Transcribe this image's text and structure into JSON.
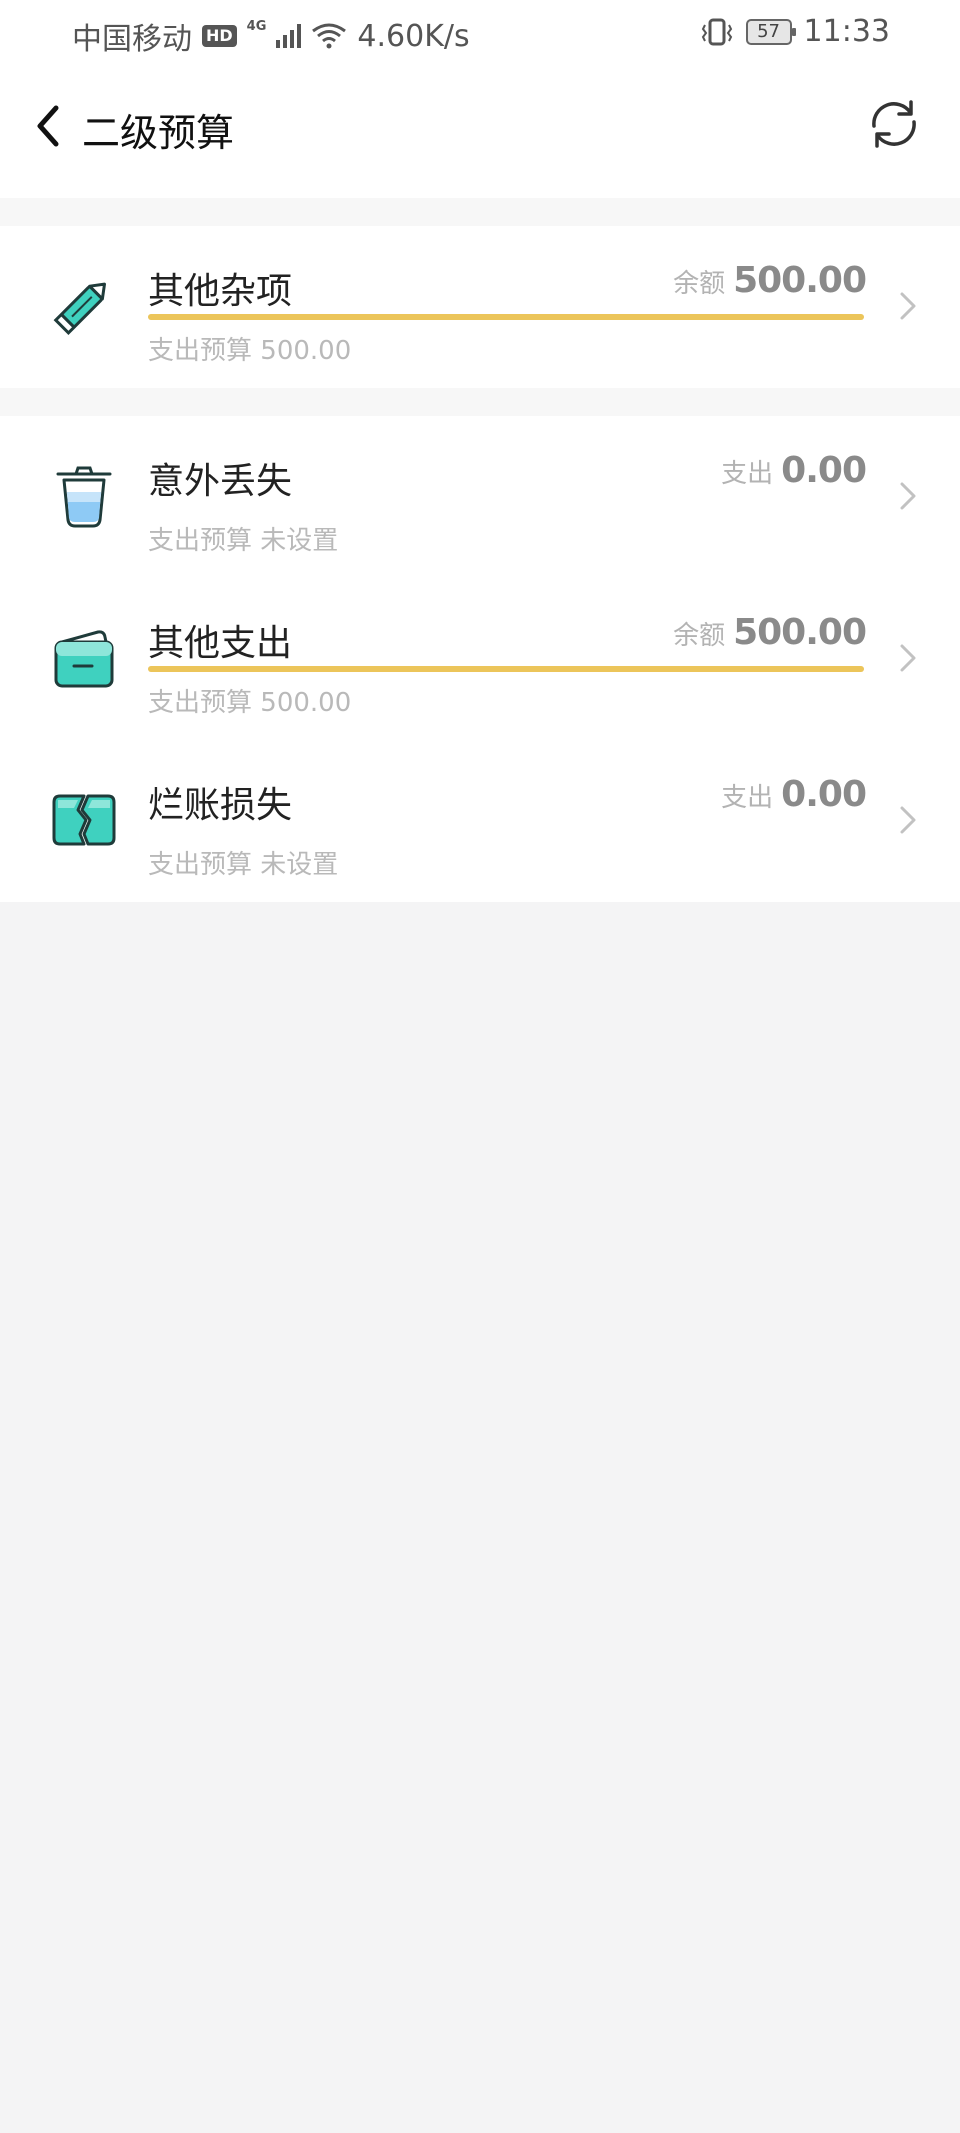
{
  "status_bar": {
    "carrier": "中国移动",
    "hd": "HD",
    "network": "4G",
    "speed": "4.60K/s",
    "battery": "57",
    "time": "11:33"
  },
  "header": {
    "title": "二级预算",
    "back_icon": "chevron-left-icon",
    "refresh_icon": "refresh-icon"
  },
  "items": [
    {
      "name": "其他杂项",
      "icon": "pencil-icon",
      "amount_label": "余额",
      "amount_value": "500.00",
      "progress": 1.0,
      "sub_label": "支出预算",
      "sub_value": "500.00"
    },
    {
      "name": "意外丢失",
      "icon": "trash-can-icon",
      "amount_label": "支出",
      "amount_value": "0.00",
      "progress": null,
      "sub_label": "支出预算",
      "sub_value": "未设置"
    },
    {
      "name": "其他支出",
      "icon": "wallet-icon",
      "amount_label": "余额",
      "amount_value": "500.00",
      "progress": 1.0,
      "sub_label": "支出预算",
      "sub_value": "500.00"
    },
    {
      "name": "烂账损失",
      "icon": "broken-card-icon",
      "amount_label": "支出",
      "amount_value": "0.00",
      "progress": null,
      "sub_label": "支出预算",
      "sub_value": "未设置"
    }
  ],
  "colors": {
    "progress": "#ecc55a",
    "icon_teal": "#3fd1bf",
    "icon_blue": "#6fb7f2",
    "background": "#f4f4f5"
  }
}
